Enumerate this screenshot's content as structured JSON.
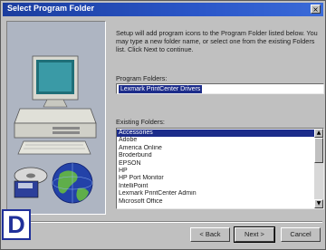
{
  "window": {
    "title": "Select Program Folder",
    "close_glyph": "×"
  },
  "description": "Setup will add program icons to the Program Folder listed below. You may type a new folder name, or select one from the existing Folders list. Click Next to continue.",
  "program_folder": {
    "label": "Program Folders:",
    "value": "Lexmark PrintCenter Drivers"
  },
  "existing_folders": {
    "label": "Existing Folders:",
    "items": [
      "Accessories",
      "Adobe",
      "America Online",
      "Broderbund",
      "EPSON",
      "HP",
      "HP Port Monitor",
      "IntelliPoint",
      "Lexmark PrintCenter Admin",
      "Microsoft Office"
    ],
    "selected_index": 0
  },
  "buttons": {
    "back": "< Back",
    "next": "Next >",
    "cancel": "Cancel"
  },
  "panel_letter": "D",
  "icons": {
    "art": "computer-with-globe-illustration",
    "scroll_up": "scroll-up-arrow-icon",
    "scroll_down": "scroll-down-arrow-icon",
    "close": "close-icon"
  },
  "colors": {
    "titlebar": "#1b3d9e",
    "selection": "#1c2c8a",
    "dialog_face": "#c0c0c0",
    "letter_badge": "#20309a"
  }
}
